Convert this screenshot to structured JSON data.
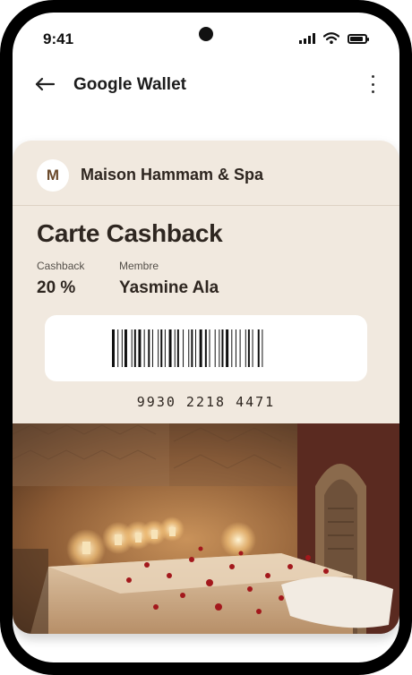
{
  "status_bar": {
    "time": "9:41",
    "icons": [
      "signal-icon",
      "wifi-icon",
      "battery-icon"
    ]
  },
  "app_bar": {
    "title": "Google Wallet",
    "back_icon": "arrow-left-icon",
    "menu_icon": "more-vert-icon"
  },
  "pass": {
    "logo_letter": "M",
    "merchant": "Maison Hammam & Spa",
    "title": "Carte Cashback",
    "fields": [
      {
        "label": "Cashback",
        "value": "20 %"
      },
      {
        "label": "Membre",
        "value": "Yasmine Ala"
      }
    ],
    "barcode_number": "9930 2218 4471",
    "image_description": "hammam-spa-photo",
    "colors": {
      "card_background": "#f1e9df",
      "text": "#2e2620",
      "logo": "#6b4a2c"
    }
  }
}
